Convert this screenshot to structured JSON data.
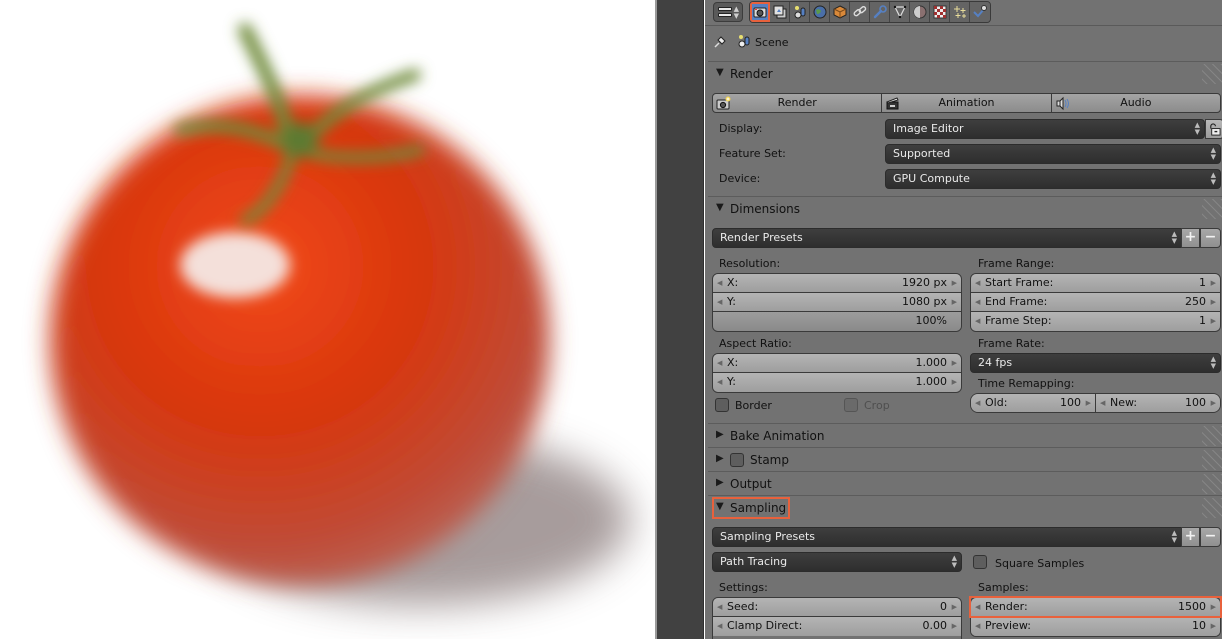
{
  "viewer": {
    "subject": "blurred tomato render",
    "colors": {
      "background": "#ffffff",
      "tomato": "#d8371a",
      "highlight": "#f2d9d0",
      "stem": "#6f8b3a",
      "shadow": "#7a6a6a"
    }
  },
  "header": {
    "context_tabs": [
      {
        "name": "render",
        "icon": "camera-icon",
        "active": true
      },
      {
        "name": "render-layers",
        "icon": "render-layers-icon",
        "active": false
      },
      {
        "name": "scene",
        "icon": "scene-icon",
        "active": false
      },
      {
        "name": "world",
        "icon": "world-icon",
        "active": false
      },
      {
        "name": "object",
        "icon": "object-cube-icon",
        "active": false
      },
      {
        "name": "constraints",
        "icon": "chain-link-icon",
        "active": false
      },
      {
        "name": "modifiers",
        "icon": "wrench-icon",
        "active": false
      },
      {
        "name": "data",
        "icon": "mesh-vertex-icon",
        "active": false
      },
      {
        "name": "material",
        "icon": "material-sphere-icon",
        "active": false
      },
      {
        "name": "texture",
        "icon": "checker-texture-icon",
        "active": false
      },
      {
        "name": "particles",
        "icon": "particles-sparkle-icon",
        "active": false
      },
      {
        "name": "physics",
        "icon": "physics-icon",
        "active": false
      }
    ],
    "highlight_color": "#e8613c",
    "active_tab_color": "#5680c2"
  },
  "context": {
    "scene_label": "Scene"
  },
  "render_panel": {
    "title": "Render",
    "expanded": true,
    "buttons": [
      {
        "label": "Render",
        "icon": "render-still-icon"
      },
      {
        "label": "Animation",
        "icon": "clapperboard-icon"
      },
      {
        "label": "Audio",
        "icon": "speaker-icon"
      }
    ],
    "display": {
      "label": "Display:",
      "value": "Image Editor"
    },
    "feature_set": {
      "label": "Feature Set:",
      "value": "Supported"
    },
    "device": {
      "label": "Device:",
      "value": "GPU Compute"
    }
  },
  "dimensions_panel": {
    "title": "Dimensions",
    "expanded": true,
    "presets": "Render Presets",
    "resolution": {
      "label": "Resolution:",
      "x_label": "X:",
      "x_value": "1920 px",
      "y_label": "Y:",
      "y_value": "1080 px",
      "percent": "100%"
    },
    "frame_range": {
      "label": "Frame Range:",
      "start_label": "Start Frame:",
      "start_value": "1",
      "end_label": "End Frame:",
      "end_value": "250",
      "step_label": "Frame Step:",
      "step_value": "1"
    },
    "aspect": {
      "label": "Aspect Ratio:",
      "x_label": "X:",
      "x_value": "1.000",
      "y_label": "Y:",
      "y_value": "1.000"
    },
    "frame_rate": {
      "label": "Frame Rate:",
      "value": "24 fps"
    },
    "time_remap": {
      "label": "Time Remapping:",
      "old_label": "Old:",
      "old_value": "100",
      "new_label": "New:",
      "new_value": "100"
    },
    "border": {
      "label": "Border",
      "checked": false
    },
    "crop": {
      "label": "Crop",
      "checked": false,
      "enabled": false
    }
  },
  "collapsed_panels": [
    {
      "title": "Bake Animation"
    },
    {
      "title": "Stamp",
      "checked": false
    },
    {
      "title": "Output"
    }
  ],
  "sampling_panel": {
    "title": "Sampling",
    "expanded": true,
    "presets": "Sampling Presets",
    "integrator": "Path Tracing",
    "square_samples": {
      "label": "Square Samples",
      "checked": false
    },
    "settings": {
      "label": "Settings:",
      "seed_label": "Seed:",
      "seed_value": "0",
      "clamp_label": "Clamp Direct:",
      "clamp_value": "0.00"
    },
    "samples": {
      "label": "Samples:",
      "render_label": "Render:",
      "render_value": "1500",
      "preview_label": "Preview:",
      "preview_value": "10"
    }
  },
  "symbols": {
    "expanded": "▼",
    "collapsed": "▶",
    "updown": "▲\n▼",
    "left": "◀",
    "right": "▶",
    "plus": "+",
    "minus": "−"
  }
}
